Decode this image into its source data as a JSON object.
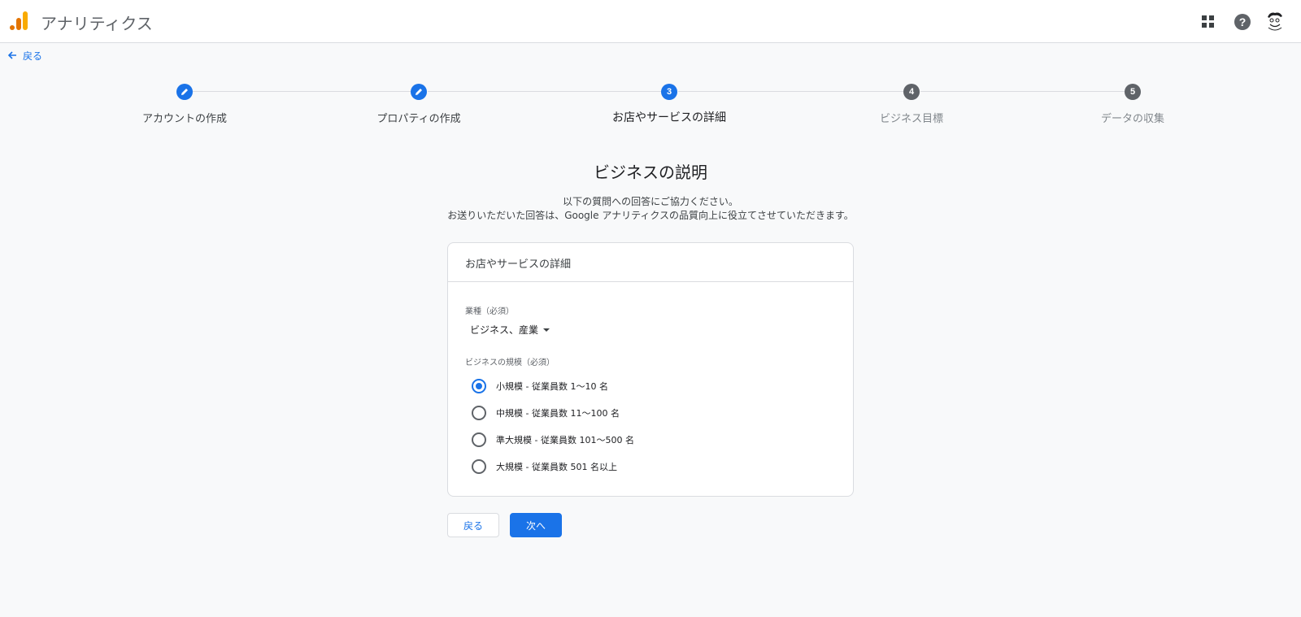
{
  "header": {
    "app_title": "アナリティクス",
    "icons": [
      "apps-icon",
      "help-icon",
      "avatar"
    ],
    "help_glyph": "?"
  },
  "nav": {
    "back_label": "戻る"
  },
  "stepper": {
    "steps": [
      {
        "number": "",
        "label": "アカウントの作成",
        "state": "done",
        "icon": "edit-icon"
      },
      {
        "number": "",
        "label": "プロパティの作成",
        "state": "done",
        "icon": "edit-icon"
      },
      {
        "number": "3",
        "label": "お店やサービスの詳細",
        "state": "active"
      },
      {
        "number": "4",
        "label": "ビジネス目標",
        "state": "pending"
      },
      {
        "number": "5",
        "label": "データの収集",
        "state": "pending"
      }
    ]
  },
  "main": {
    "title": "ビジネスの説明",
    "subtitle_line1": "以下の質問への回答にご協力ください。",
    "subtitle_line2": "お送りいただいた回答は、Google アナリティクスの品質向上に役立てさせていただきます。"
  },
  "card": {
    "title": "お店やサービスの詳細",
    "industry_label": "業種（必須）",
    "industry_value": "ビジネス、産業",
    "size_label": "ビジネスの規模（必須）",
    "size_options": [
      {
        "label": "小規模 - 従業員数 1〜10 名",
        "checked": true
      },
      {
        "label": "中規模 - 従業員数 11〜100 名",
        "checked": false
      },
      {
        "label": "準大規模 - 従業員数 101〜500 名",
        "checked": false
      },
      {
        "label": "大規模 - 従業員数 501 名以上",
        "checked": false
      }
    ]
  },
  "actions": {
    "back_label": "戻る",
    "next_label": "次へ"
  },
  "colors": {
    "accent": "#1a73e8",
    "logo_dark": "#e37400",
    "logo_light": "#f9ab00"
  }
}
